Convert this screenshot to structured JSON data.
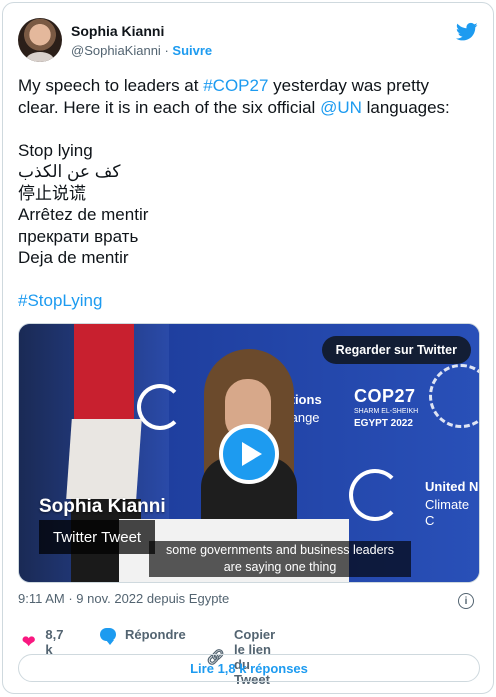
{
  "user": {
    "name": "Sophia Kianni",
    "handle": "@SophiaKianni",
    "separator": "·",
    "follow_label": "Suivre"
  },
  "tweet": {
    "line1_pre": "My speech to leaders at ",
    "line1_hashtag": "#COP27",
    "line1_post": " yesterday was pretty",
    "line2_pre": "clear. Here it is in each of the six official ",
    "line2_mention": "@UN",
    "line2_post": " languages:",
    "languages": [
      "Stop lying",
      "كف عن الكذب",
      "停止说谎",
      "Arrêtez de mentir",
      "прекрати врать",
      "Deja de mentir"
    ],
    "closing_hashtag": "#StopLying"
  },
  "media": {
    "watch_label": "Regarder sur Twitter",
    "overlay_name": "Sophia Kianni",
    "overlay_title": "Twitter Tweet",
    "caption_line1": "some governments and business leaders",
    "caption_line2": "are saying one thing",
    "backdrop_un1": "Nations",
    "backdrop_un2": "Change",
    "backdrop_cop": "COP27",
    "backdrop_cop_sub": "SHARM EL-SHEIKH",
    "backdrop_cop_country": "EGYPT 2022",
    "backdrop_un3": "United N",
    "backdrop_un4": "Climate C"
  },
  "meta": {
    "timestamp": "9:11 AM · 9 nov. 2022 depuis Egypte",
    "info_glyph": "i"
  },
  "actions": {
    "like_count": "8,7 k",
    "reply_label": "Répondre",
    "copy_link_label": "Copier le lien du Tweet"
  },
  "replies_label": "Lire 1,8 k réponses",
  "colors": {
    "accent": "#1d9bf0",
    "like": "#f91880",
    "secondary_text": "#536471",
    "border": "#cfd9de"
  },
  "icons": [
    "twitter-bird-icon",
    "play-icon",
    "info-icon",
    "heart-icon",
    "reply-icon",
    "link-icon"
  ]
}
